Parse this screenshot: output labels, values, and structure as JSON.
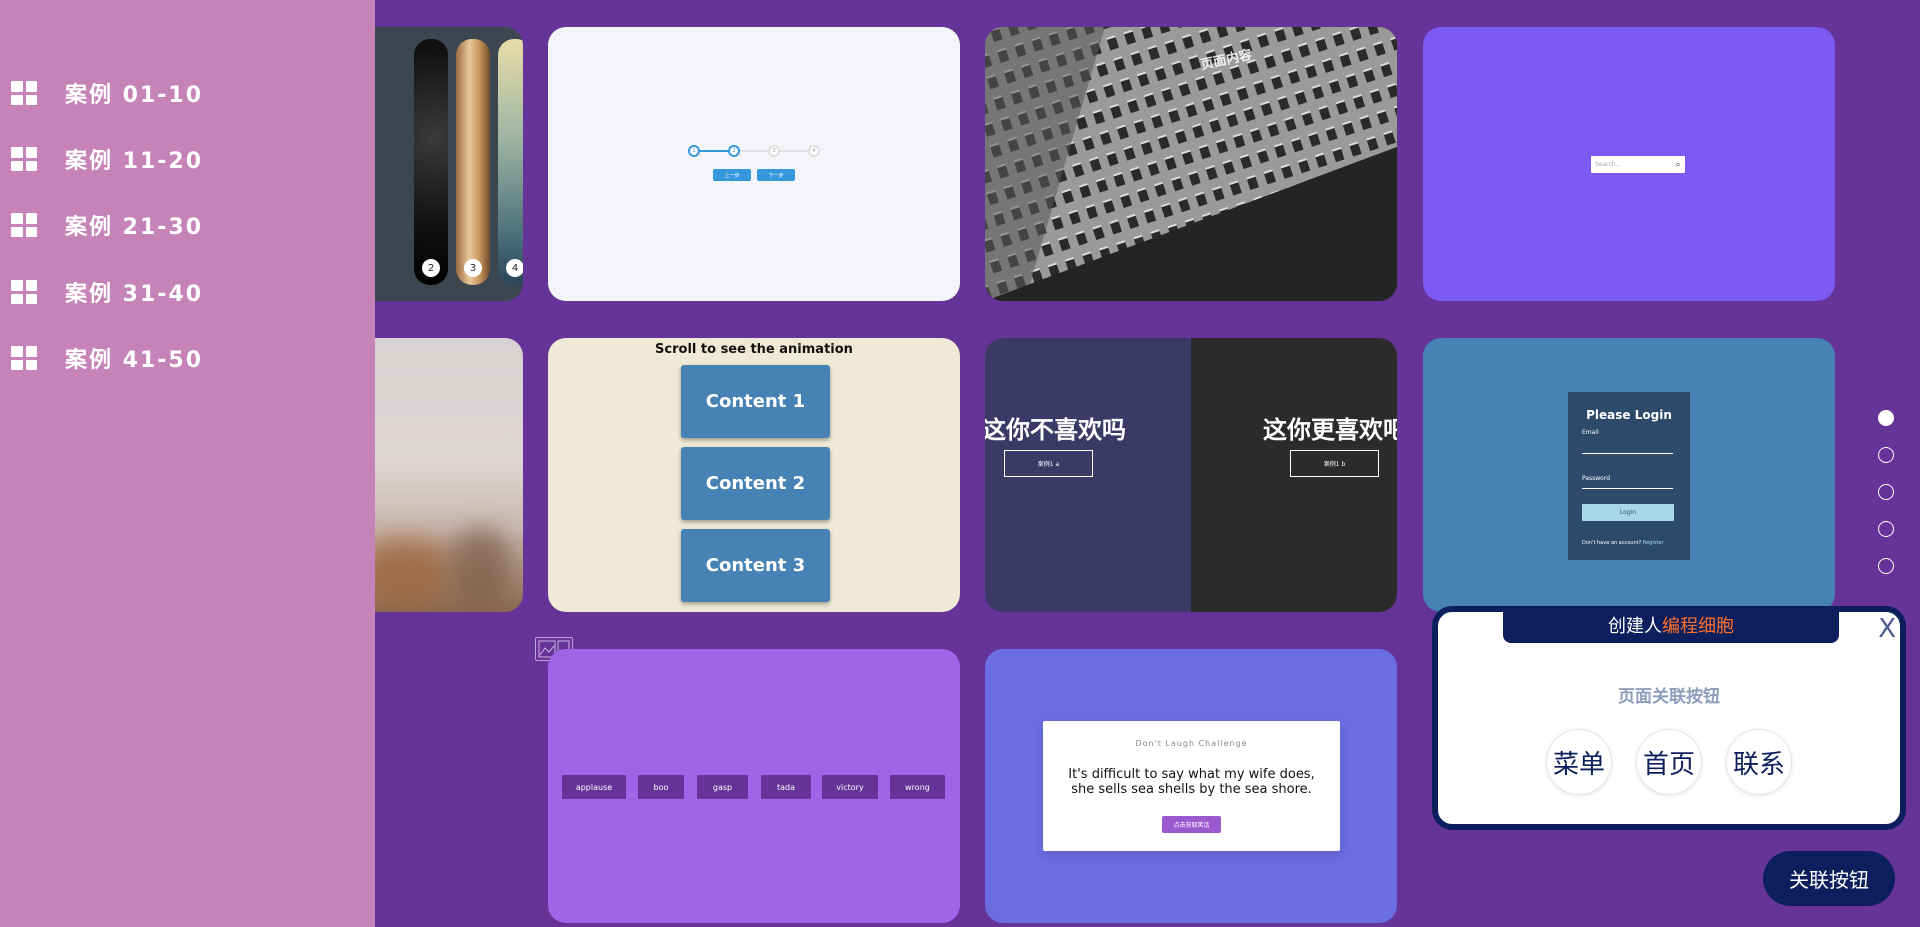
{
  "sidebar": {
    "items": [
      {
        "label": "案例 01-10",
        "icon": "grid-icon"
      },
      {
        "label": "案例 11-20",
        "icon": "grid-icon"
      },
      {
        "label": "案例 21-30",
        "icon": "grid-icon"
      },
      {
        "label": "案例 31-40",
        "icon": "grid-icon"
      },
      {
        "label": "案例 41-50",
        "icon": "grid-icon"
      }
    ]
  },
  "cards": {
    "strips": {
      "numbers": [
        "2",
        "3",
        "4"
      ]
    },
    "progress": {
      "steps": [
        "1",
        "2",
        "3",
        "4"
      ],
      "prev_label": "上一步",
      "next_label": "下一步"
    },
    "building": {
      "overlay_text": "页面内容"
    },
    "search": {
      "placeholder": "Search...",
      "icon": "search-icon"
    },
    "scroll": {
      "title": "Scroll to see the animation",
      "contents": [
        "Content 1",
        "Content 2",
        "Content 3"
      ]
    },
    "split": {
      "left_heading": "这你不喜欢吗",
      "left_button": "案例1 a",
      "right_heading": "这你更喜欢吧",
      "right_button": "案例1 b"
    },
    "login": {
      "title": "Please Login",
      "email_label": "Email",
      "password_label": "Password",
      "login_button": "Login",
      "register_text": "Don't have an account?",
      "register_link": "Register"
    },
    "sounds": {
      "buttons": [
        "applause",
        "boo",
        "gasp",
        "tada",
        "victory",
        "wrong"
      ]
    },
    "joke": {
      "title": "Don't Laugh Challenge",
      "line1": "It's difficult to say what my wife does,",
      "line2": "she sells sea shells by the sea shore.",
      "button": "点击获取笑话"
    }
  },
  "page_dots": {
    "count": 5,
    "active_index": 0
  },
  "popup": {
    "header_prefix": "创建人",
    "header_accent": "编程细胞",
    "close_label": "X",
    "subtitle": "页面关联按钮",
    "buttons": [
      "菜单",
      "首页",
      "联系"
    ]
  },
  "assoc_button": "关联按钮",
  "colors": {
    "background": "#663399",
    "sidebar": "#c683b8",
    "popup_navy": "#0c1f5c",
    "accent_orange": "#ff6f2c"
  }
}
